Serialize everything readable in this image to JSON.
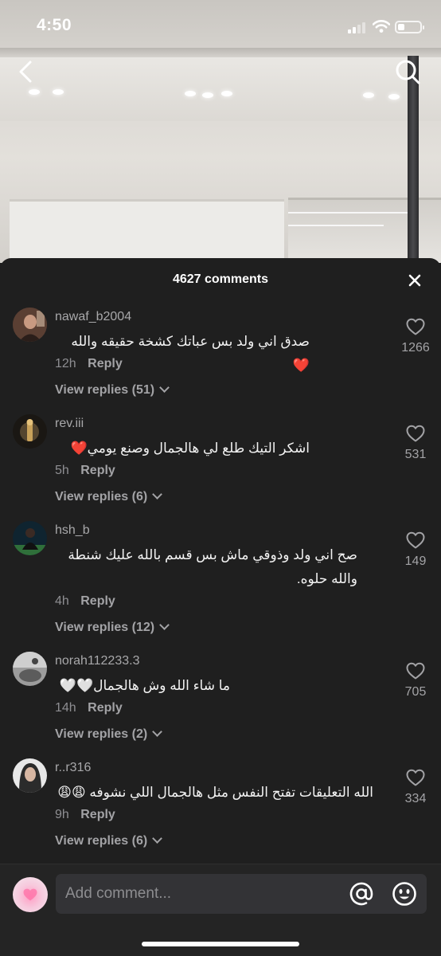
{
  "status_bar": {
    "time": "4:50"
  },
  "sheet": {
    "comments_count": "4627 comments"
  },
  "comments": [
    {
      "username": "nawaf_b2004",
      "text": "صدق اني ولد بس عباتك كشخة حقيقه والله ❤️",
      "time": "12h",
      "reply_label": "Reply",
      "view_replies": "View replies (51)",
      "likes": "1266"
    },
    {
      "username": "rev.iii",
      "text": "اشكر التيك طلع لي هالجمال وصنع يومي❤️",
      "time": "5h",
      "reply_label": "Reply",
      "view_replies": "View replies (6)",
      "likes": "531"
    },
    {
      "username": "hsh_b",
      "text": "صح اني ولد وذوقي ماش بس قسم بالله عليك شنطة والله حلوه.",
      "time": "4h",
      "reply_label": "Reply",
      "view_replies": "View replies (12)",
      "likes": "149"
    },
    {
      "username": "norah112233.3",
      "text": "ما شاء الله وش هالجمال🤍🤍",
      "time": "14h",
      "reply_label": "Reply",
      "view_replies": "View replies (2)",
      "likes": "705"
    },
    {
      "username": "r..r316",
      "text": "الله التعليقات تفتح النفس مثل هالجمال اللي نشوفه 😩😩",
      "time": "9h",
      "reply_label": "Reply",
      "view_replies": "View replies (6)",
      "likes": "334"
    }
  ],
  "input": {
    "placeholder": "Add comment..."
  },
  "icons": {
    "back": "chevron-left-icon",
    "search": "search-icon",
    "close": "close-icon",
    "like": "heart-outline-icon",
    "mention": "at-icon",
    "emoji": "smiley-icon"
  },
  "colors": {
    "sheet_bg": "#1f1f1f",
    "secondary_text": "#a3a3a6"
  }
}
